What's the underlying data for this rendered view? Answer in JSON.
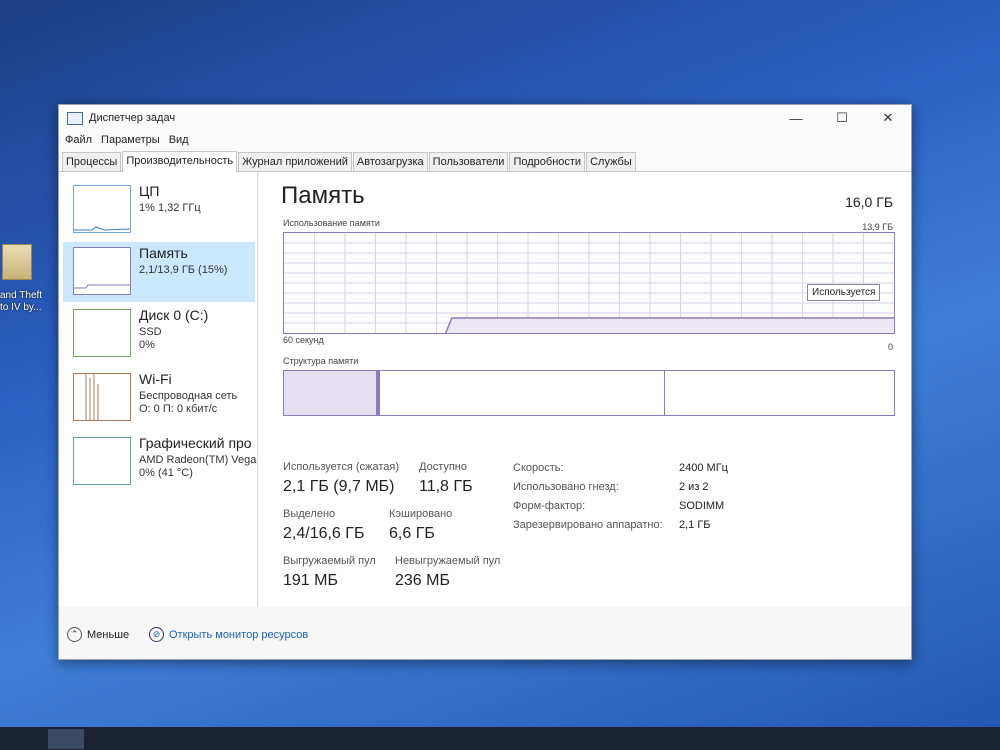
{
  "desktop": {
    "icon_label_line1": "and Theft",
    "icon_label_line2": "to IV by..."
  },
  "window": {
    "title": "Диспетчер задач",
    "minimize": "—",
    "maximize": "☐",
    "close": "✕",
    "menu": [
      "Файл",
      "Параметры",
      "Вид"
    ],
    "tabs": [
      "Процессы",
      "Производительность",
      "Журнал приложений",
      "Автозагрузка",
      "Пользователи",
      "Подробности",
      "Службы"
    ],
    "active_tab": 1
  },
  "sidebar": {
    "items": [
      {
        "name": "ЦП",
        "sub1": "1% 1,32 ГГц",
        "sub2": ""
      },
      {
        "name": "Память",
        "sub1": "2,1/13,9 ГБ (15%)",
        "sub2": ""
      },
      {
        "name": "Диск 0 (C:)",
        "sub1": "SSD",
        "sub2": "0%"
      },
      {
        "name": "Wi-Fi",
        "sub1": "Беспроводная сеть",
        "sub2": "О: 0 П: 0 кбит/с"
      },
      {
        "name": "Графический про",
        "sub1": "AMD Radeon(TM) Vega",
        "sub2": "0% (41 °C)"
      }
    ],
    "selected": 1
  },
  "memory": {
    "title": "Память",
    "total": "16,0 ГБ",
    "usage_label": "Использование памяти",
    "usage_max": "13,9 ГБ",
    "time_left": "60 секунд",
    "time_right": "0",
    "tooltip": "Используется",
    "composition_label": "Структура памяти",
    "usage_fraction": 0.15,
    "stats": {
      "in_use_label": "Используется (сжатая)",
      "in_use_value": "2,1 ГБ (9,7 МБ)",
      "available_label": "Доступно",
      "available_value": "11,8 ГБ",
      "committed_label": "Выделено",
      "committed_value": "2,4/16,6 ГБ",
      "cached_label": "Кэшировано",
      "cached_value": "6,6 ГБ",
      "paged_label": "Выгружаемый пул",
      "paged_value": "191 МБ",
      "nonpaged_label": "Невыгружаемый пул",
      "nonpaged_value": "236 МБ"
    },
    "specs": [
      {
        "label": "Скорость:",
        "value": "2400 МГц"
      },
      {
        "label": "Использовано гнезд:",
        "value": "2 из 2"
      },
      {
        "label": "Форм-фактор:",
        "value": "SODIMM"
      },
      {
        "label": "Зарезервировано аппаратно:",
        "value": "2,1 ГБ"
      }
    ]
  },
  "footer": {
    "less": "Меньше",
    "resource_monitor": "Открыть монитор ресурсов"
  },
  "colors": {
    "memory_accent": "#8e7ab5",
    "selected_bg": "#cce8ff",
    "link": "#1a5fb4"
  }
}
